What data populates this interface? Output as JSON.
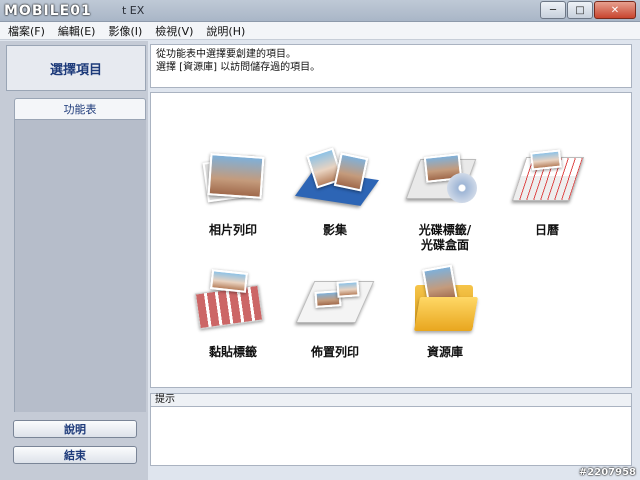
{
  "window": {
    "logo_text": "MOBILE01",
    "title_fragment": "t EX",
    "minimize": "─",
    "maximize": "□",
    "close": "✕"
  },
  "menu": [
    "檔案(F)",
    "編輯(E)",
    "影像(I)",
    "檢視(V)",
    "說明(H)"
  ],
  "sidebar": {
    "header": "選擇項目",
    "tab": "功能表",
    "help_button": "說明",
    "exit_button": "結束"
  },
  "instructions": {
    "line1": "從功能表中選擇要創建的項目。",
    "line2": "選擇 [資源庫] 以訪問儲存過的項目。"
  },
  "items": [
    {
      "label": "相片列印",
      "icon": "photo-print-icon"
    },
    {
      "label": "影集",
      "icon": "album-icon"
    },
    {
      "label": "光碟標籤/\n光碟盒面",
      "icon": "disc-label-icon"
    },
    {
      "label": "日曆",
      "icon": "calendar-icon"
    },
    {
      "label": "黏貼標籤",
      "icon": "sticker-icon"
    },
    {
      "label": "佈置列印",
      "icon": "layout-print-icon"
    },
    {
      "label": "資源庫",
      "icon": "library-folder-icon"
    }
  ],
  "hint": {
    "title": "提示"
  },
  "watermark": "#2207958"
}
